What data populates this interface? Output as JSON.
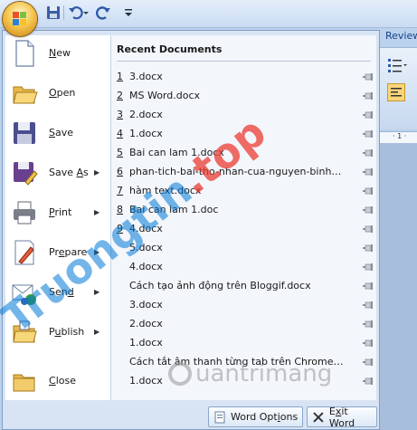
{
  "quick_access": {
    "office_button_icon": "office-logo-icon",
    "save_icon": "floppy-save-icon",
    "undo_icon": "undo-icon",
    "redo_icon": "redo-icon",
    "customize_icon": "chevron-down-icon"
  },
  "ribbon": {
    "tab_label": "Review",
    "ruler_text": "· 1 ·"
  },
  "commands": [
    {
      "key": "N",
      "rest": "ew",
      "has_submenu": false,
      "icon": "new-document-icon"
    },
    {
      "key": "O",
      "rest": "pen",
      "has_submenu": false,
      "icon": "open-folder-icon"
    },
    {
      "key": "S",
      "rest": "ave",
      "has_submenu": false,
      "icon": "save-floppy-icon"
    },
    {
      "pre": "Save ",
      "key": "A",
      "rest": "s",
      "has_submenu": true,
      "icon": "save-as-icon"
    },
    {
      "key": "P",
      "rest": "rint",
      "has_submenu": true,
      "icon": "printer-icon"
    },
    {
      "pre": "Pr",
      "key": "e",
      "rest": "pare",
      "has_submenu": true,
      "icon": "prepare-pencil-icon"
    },
    {
      "pre": "Sen",
      "key": "d",
      "rest": "",
      "has_submenu": true,
      "icon": "send-icon"
    },
    {
      "pre": "P",
      "key": "u",
      "rest": "blish",
      "has_submenu": true,
      "icon": "publish-folder-icon"
    },
    {
      "key": "C",
      "rest": "lose",
      "has_submenu": false,
      "icon": "close-folder-icon"
    }
  ],
  "recent": {
    "title": "Recent Documents",
    "items": [
      {
        "num": "1",
        "name": "3.docx"
      },
      {
        "num": "2",
        "name": "MS Word.docx"
      },
      {
        "num": "3",
        "name": "2.docx"
      },
      {
        "num": "4",
        "name": "1.docx"
      },
      {
        "num": "5",
        "name": "Bai can lam 1.docx"
      },
      {
        "num": "6",
        "name": "phan-tich-bai-tho-nhan-cua-nguyen-binh-khi..."
      },
      {
        "num": "7",
        "name": "hàm text.docx"
      },
      {
        "num": "8",
        "name": "Bai can lam 1.doc"
      },
      {
        "num": "9",
        "name": "4.docx"
      },
      {
        "num": "",
        "name": "5.docx"
      },
      {
        "num": "",
        "name": "4.docx"
      },
      {
        "num": "",
        "name": "Cách tạo ảnh động trên Bloggif.docx"
      },
      {
        "num": "",
        "name": "3.docx"
      },
      {
        "num": "",
        "name": "2.docx"
      },
      {
        "num": "",
        "name": "1.docx"
      },
      {
        "num": "",
        "name": "Cách tắt âm thanh từng tab trên Chrome.docx"
      },
      {
        "num": "",
        "name": "1.docx"
      }
    ]
  },
  "bottom": {
    "options_pre": "Word Opt",
    "options_key": "i",
    "options_rest": "ons",
    "exit_pre": "E",
    "exit_key": "x",
    "exit_rest": "it Word"
  },
  "watermarks": {
    "left_main": "Truongtin",
    "left_dot": ".",
    "left_tld": "top",
    "right": "uantrimang"
  },
  "colors": {
    "menu_bg": "#d8e4f3",
    "accent_blue": "#15428b",
    "office_orange": "#f6c74e"
  }
}
